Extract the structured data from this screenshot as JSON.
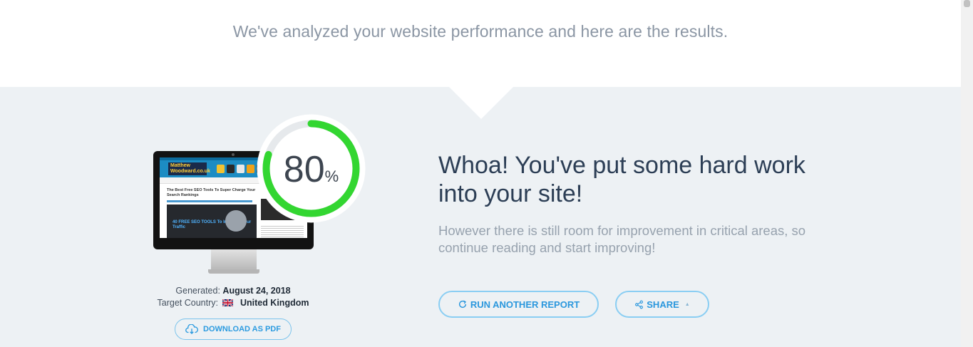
{
  "intro": "We've analyzed your website performance and here are the results.",
  "score": {
    "value": "80",
    "unit": "%",
    "percent": 80
  },
  "preview": {
    "logo": "Matthew Woodward.co.uk",
    "article_title": "The Best Free SEO Tools To Super Charge Your Search Rankings",
    "image_text": "40 FREE SEO TOOLS To Increase Your Traffic",
    "tag": "FREE"
  },
  "report": {
    "generated_label": "Generated:",
    "generated_value": "August 24, 2018",
    "country_label": "Target Country:",
    "country_value": "United Kingdom",
    "download_label": "DOWNLOAD AS PDF"
  },
  "result": {
    "headline": "Whoa! You've put some hard work into your site!",
    "subtext": "However there is still room for improvement in critical areas, so continue reading and start improving!"
  },
  "actions": {
    "run_label": "RUN ANOTHER REPORT",
    "share_label": "SHARE"
  },
  "colors": {
    "accent": "#2a97dd",
    "score_ring": "#33d631",
    "panel": "#edf1f4"
  }
}
